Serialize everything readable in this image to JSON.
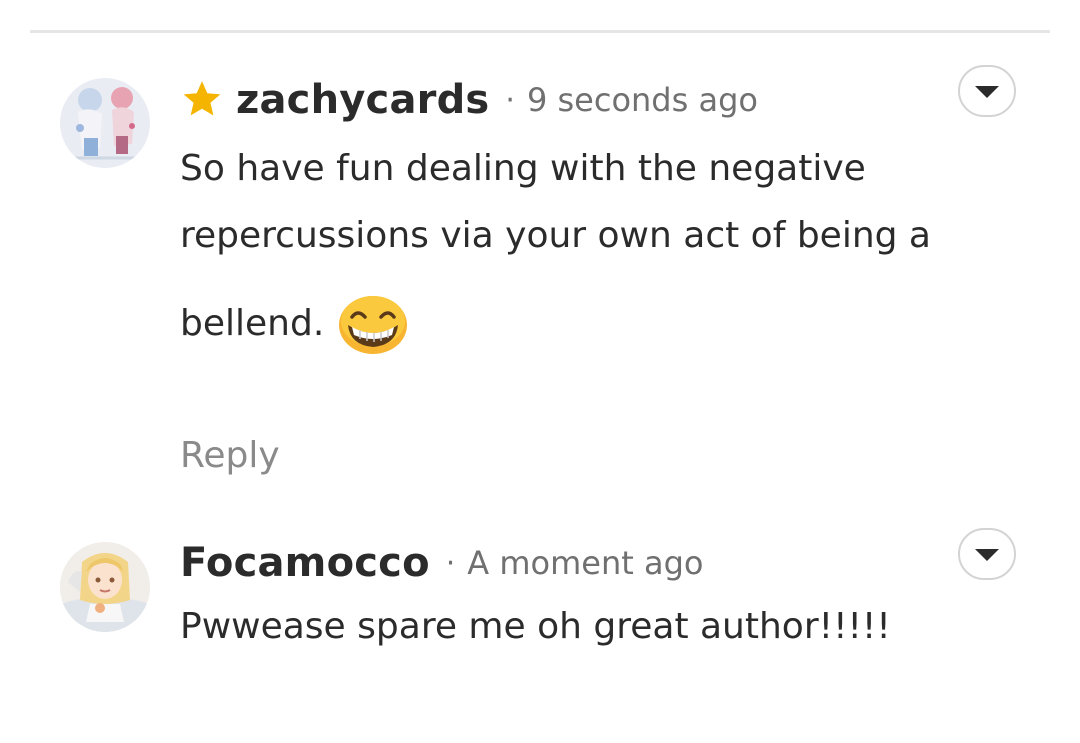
{
  "comments": [
    {
      "username": "zachycards",
      "separator": "·",
      "timestamp": "9 seconds ago",
      "badge_icon": "star-icon",
      "badge_color": "#f5b400",
      "lines": [
        "So have fun dealing with the negative",
        "repercussions via your own act of being a",
        "bellend."
      ],
      "emoji": "grinning-face-icon",
      "reply_label": "Reply"
    },
    {
      "username": "Focamocco",
      "separator": "·",
      "timestamp": "A moment ago",
      "lines": [
        "Pwwease spare me oh great author!!!!!"
      ]
    }
  ]
}
